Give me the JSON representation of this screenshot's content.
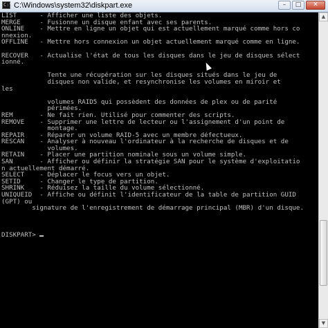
{
  "window": {
    "title": "C:\\Windows\\system32\\diskpart.exe",
    "icon_glyph": "C:\\",
    "minimize_glyph": "–",
    "maximize_glyph": "□",
    "close_glyph": "✕"
  },
  "console": {
    "lines": [
      "LIST      - Afficher une liste des objets.",
      "MERGE     - Fusionne un disque enfant avec ses parents.",
      "ONLINE    - Mettre en ligne un objet qui est actuellement marqué comme hors co",
      "nnexion.",
      "OFFLINE   - Mettre hors connexion un objet actuellement marqué comme en ligne.",
      "",
      "RECOVER   - Actualise l'état de tous les disques dans le jeu de disques sélect",
      "ionné.",
      "",
      "            Tente une récupération sur les disques situés dans le jeu de",
      "            disques non valide, et resynchronise les volumes en miroir et",
      "les",
      "",
      "            volumes RAID5 qui possèdent des données de plex ou de parité",
      "            périmées.",
      "REM       - Ne fait rien. Utilisé pour commenter des scripts.",
      "REMOVE    - Supprimer une lettre de lecteur ou l'assignement d'un point de",
      "            montage.",
      "REPAIR    - Réparer un volume RAID-5 avec un membre défectueux.",
      "RESCAN    - Analyser à nouveau l'ordinateur à la recherche de disques et de",
      "            volumes.",
      "RETAIN    - Placer une partition nominale sous un volume simple.",
      "SAN       - Afficher ou définir la stratégie SAN pour le système d'exploitatio",
      "n actuellement démarré.",
      "SELECT    - Déplacer le focus vers un objet.",
      "SETID     - Changer le type de partition.",
      "SHRINK    - Réduisez la taille du volume sélectionné.",
      "UNIQUEID  - Affiche ou définit l'identificateur de la table de partition GUID",
      "(GPT) ou",
      "        signature de l'enregistrement de démarrage principal (MBR) d'un disque.",
      "",
      "",
      "",
      "DISKPART> "
    ]
  }
}
